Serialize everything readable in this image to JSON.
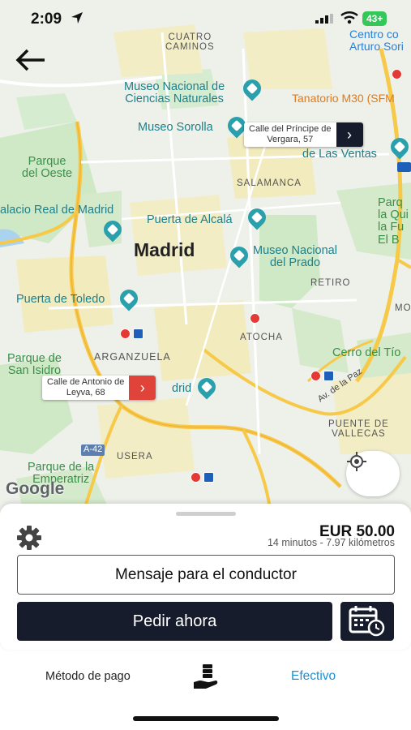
{
  "status_bar": {
    "time": "2:09",
    "battery": "43+"
  },
  "map": {
    "city": "Madrid",
    "labels": {
      "cuatro_caminos": "CUATRO\nCAMINOS",
      "centro_arturo": "Centro co\nArturo Sori",
      "museo_ciencias": "Museo Nacional de\nCiencias Naturales",
      "tanatorio": "Tanatorio M30 (SFM",
      "museo_sorolla": "Museo Sorolla",
      "las_ventas": "de Las Ventas",
      "parque_oeste": "Parque\ndel Oeste",
      "salamanca": "SALAMANCA",
      "palacio_real": "alacio Real de Madrid",
      "puerta_alcala": "Puerta de Alcalá",
      "parque_quinta": "Parq\nla Qui\nla Fu\nEl B",
      "museo_prado": "Museo Nacional\ndel Prado",
      "retiro": "RETIRO",
      "puerta_toledo": "Puerta de Toledo",
      "mo": "MO",
      "atocha": "ATOCHA",
      "parque_san_isidro": "Parque de\nSan Isidro",
      "arganzuela": "ARGANZUELA",
      "cerro_tio": "Cerro del Tío",
      "drid": "drid",
      "av_paz": "Av. de la Paz",
      "puente_vallecas": "PUENTE DE\nVALLECAS",
      "a42": "A-42",
      "usera": "USERA",
      "parque_emperatriz": "Parque de la\nEmperatriz"
    },
    "destination_callout": "Calle del Príncipe de\nVergara, 57",
    "origin_callout": "Calle de Antonio de\nLeyva, 68",
    "google_logo": "Google"
  },
  "trip": {
    "price": "EUR 50.00",
    "summary": "14 minutos - 7.97 kilómetros",
    "message_button": "Mensaje para el conductor",
    "order_button": "Pedir ahora"
  },
  "payment": {
    "label": "Método de pago",
    "value": "Efectivo"
  },
  "colors": {
    "primary_dark": "#171c2c",
    "accent_link": "#1a8fd6",
    "origin_marker": "#e0433a",
    "poi_teal": "#1f7f89"
  },
  "icons": [
    "back-arrow-icon",
    "location-arrow-icon",
    "gear-icon",
    "calendar-clock-icon",
    "cash-hand-icon",
    "recenter-icon"
  ]
}
